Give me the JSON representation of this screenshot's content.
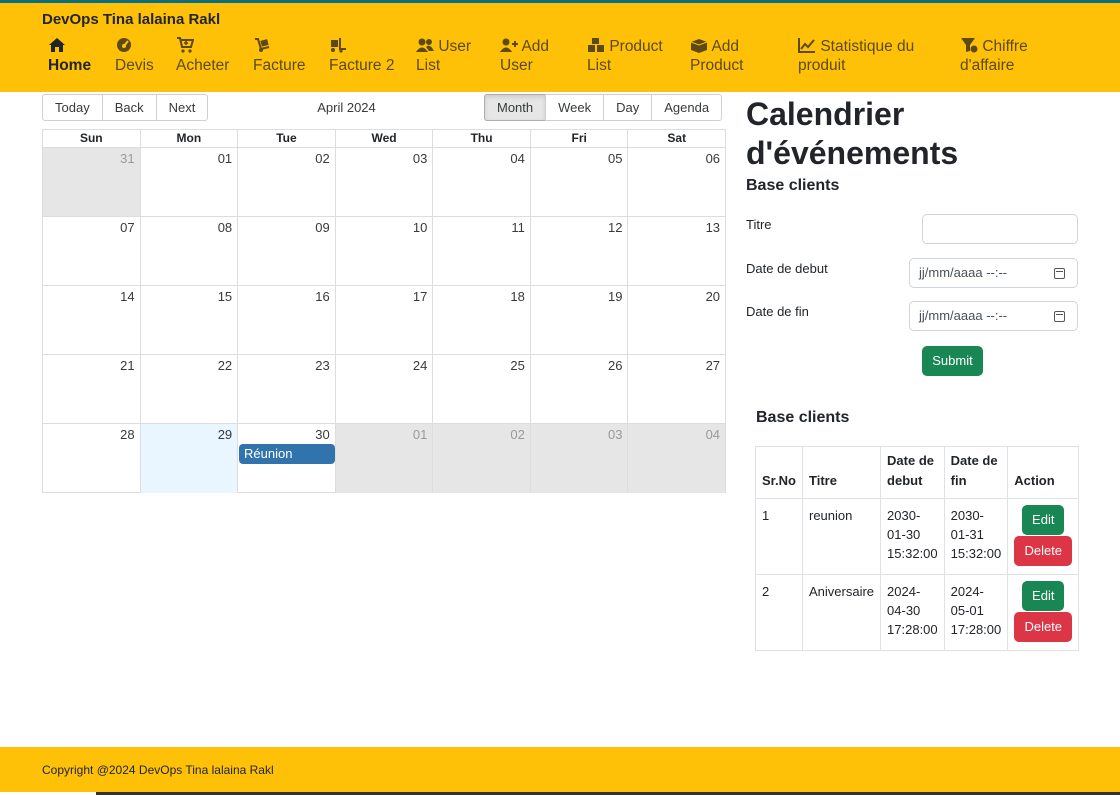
{
  "brand": "DevOps Tina lalaina Rakl",
  "nav": [
    {
      "label1": "Home",
      "label2": "",
      "icon": "home-icon"
    },
    {
      "label1": "Devis",
      "label2": "",
      "icon": "gauge-icon"
    },
    {
      "label1": "Acheter",
      "label2": "",
      "icon": "cart-icon"
    },
    {
      "label1": "Facture",
      "label2": "",
      "icon": "dolly-icon"
    },
    {
      "label1": "Facture 2",
      "label2": "",
      "icon": "truck-loading-icon"
    },
    {
      "label1": "User",
      "label2": "List",
      "icon": "users-icon"
    },
    {
      "label1": "Add",
      "label2": "User",
      "icon": "user-plus-icon"
    },
    {
      "label1": "Product",
      "label2": "List",
      "icon": "boxes-icon"
    },
    {
      "label1": "Add",
      "label2": "Product",
      "icon": "box-open-icon"
    },
    {
      "label1": "Statistique du",
      "label2": "produit",
      "icon": "chart-line-icon"
    },
    {
      "label1": "Chiffre",
      "label2": "d'affaire",
      "icon": "funnel-dollar-icon"
    }
  ],
  "toolbar": {
    "today": "Today",
    "back": "Back",
    "next": "Next",
    "label": "April 2024",
    "month": "Month",
    "week": "Week",
    "day": "Day",
    "agenda": "Agenda"
  },
  "calendar": {
    "weekdays": [
      "Sun",
      "Mon",
      "Tue",
      "Wed",
      "Thu",
      "Fri",
      "Sat"
    ],
    "weeks": [
      [
        "31",
        "01",
        "02",
        "03",
        "04",
        "05",
        "06"
      ],
      [
        "07",
        "08",
        "09",
        "10",
        "11",
        "12",
        "13"
      ],
      [
        "14",
        "15",
        "16",
        "17",
        "18",
        "19",
        "20"
      ],
      [
        "21",
        "22",
        "23",
        "24",
        "25",
        "26",
        "27"
      ],
      [
        "28",
        "29",
        "30",
        "01",
        "02",
        "03",
        "04"
      ]
    ],
    "event": "Réunion"
  },
  "panel": {
    "title1": "Calendrier",
    "title2": "d'événements",
    "subtitle": "Base clients",
    "titre_label": "Titre",
    "titre_value": "",
    "debut_label": "Date de debut",
    "debut_placeholder": "jj/mm/aaaa --:--",
    "fin_label": "Date de fin",
    "fin_placeholder": "jj/mm/aaaa --:--",
    "submit": "Submit"
  },
  "table": {
    "heading": "Base clients",
    "headers": {
      "srno": "Sr.No",
      "titre": "Titre",
      "debut1": "Date de",
      "debut2": "debut",
      "fin1": "Date de",
      "fin2": "fin",
      "action": "Action"
    },
    "edit_label": "Edit",
    "delete_label": "Delete",
    "rows": [
      {
        "srno": "1",
        "titre": "reunion",
        "debut": [
          "2030-",
          "01-30",
          "15:32:00"
        ],
        "fin": [
          "2030-",
          "01-31",
          "15:32:00"
        ]
      },
      {
        "srno": "2",
        "titre": "Aniversaire",
        "debut": [
          "2024-",
          "04-30",
          "17:28:00"
        ],
        "fin": [
          "2024-",
          "05-01",
          "17:28:00"
        ]
      }
    ]
  },
  "footer": "Copyright @2024 DevOps Tina lalaina Rakl",
  "colors": {
    "brand": "#ffc107",
    "event": "#3174ad",
    "success": "#198754",
    "danger": "#dc3545"
  }
}
